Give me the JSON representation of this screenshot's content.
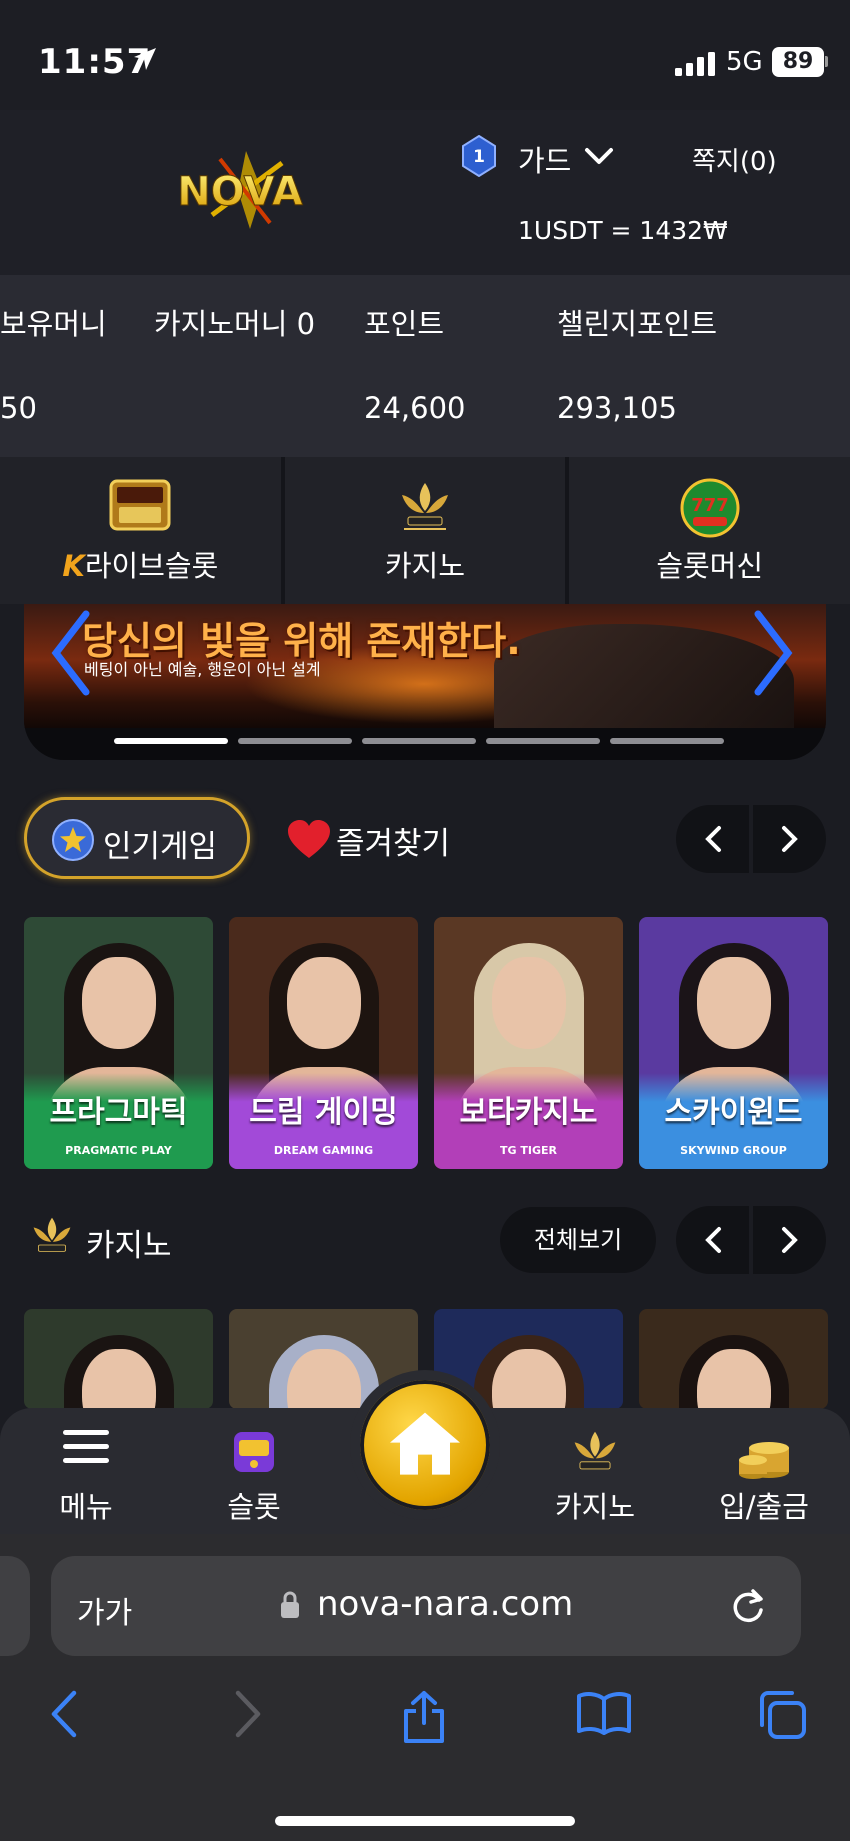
{
  "status": {
    "time": "11:57",
    "network": "5G",
    "battery": "89"
  },
  "header": {
    "logo_text": "NOVA",
    "level": "1",
    "username": "가드",
    "messages": "쪽지(0)",
    "rate": "1USDT = 1432₩"
  },
  "balance": {
    "labels": [
      "보유머니",
      "카지노머니 0",
      "포인트",
      "챌린지포인트"
    ],
    "values": [
      "50",
      "24,600",
      "293,105"
    ]
  },
  "categories": [
    {
      "label": "라이브슬롯",
      "icon": "live-slot-icon",
      "prefix": "K"
    },
    {
      "label": "카지노",
      "icon": "k-slot-casino-icon"
    },
    {
      "label": "슬롯머신",
      "icon": "777-slots-icon"
    }
  ],
  "banner": {
    "title": "당신의 빛을 위해 존재한다.",
    "subtitle": "베팅이 아닌 예술, 행운이 아닌 설계",
    "slides": 5,
    "active_slide": 0
  },
  "popular": {
    "tab_popular": "인기게임",
    "tab_favorites": "즐겨찾기"
  },
  "popular_games": [
    {
      "name": "프라그마틱",
      "provider": "PRAGMATIC PLAY",
      "band": "#1f9b4f",
      "bg": "#2e4a36",
      "hair": "#1a1412"
    },
    {
      "name": "드림 게이밍",
      "provider": "DREAM GAMING",
      "band": "#a24ad8",
      "bg": "#4a2a1c",
      "hair": "#1d1410"
    },
    {
      "name": "보타카지노",
      "provider": "TG TIGER",
      "band": "#b23fb8",
      "bg": "#5a3824",
      "hair": "#d8c8a8"
    },
    {
      "name": "스카이윈드",
      "provider": "SKYWIND GROUP",
      "band": "#3b8fe0",
      "bg": "#5a3aa0",
      "hair": "#1b1418"
    }
  ],
  "casino": {
    "title": "카지노",
    "view_all": "전체보기"
  },
  "casino_games": [
    {
      "bg": "#2e3a2c",
      "hair": "#1a1412"
    },
    {
      "bg": "#4a4030",
      "hair": "#a8b0c8"
    },
    {
      "bg": "#1e2a5a",
      "hair": "#3a2418"
    },
    {
      "bg": "#3a2a1c",
      "hair": "#1a1210"
    }
  ],
  "tabbar": {
    "menu": "메뉴",
    "slot": "슬롯",
    "casino": "카지노",
    "deposit": "입/출금"
  },
  "browser": {
    "aa": "가가",
    "url": "nova-nara.com"
  },
  "colors": {
    "accent_gold": "#d4a32a",
    "bg": "#1b1c22"
  }
}
